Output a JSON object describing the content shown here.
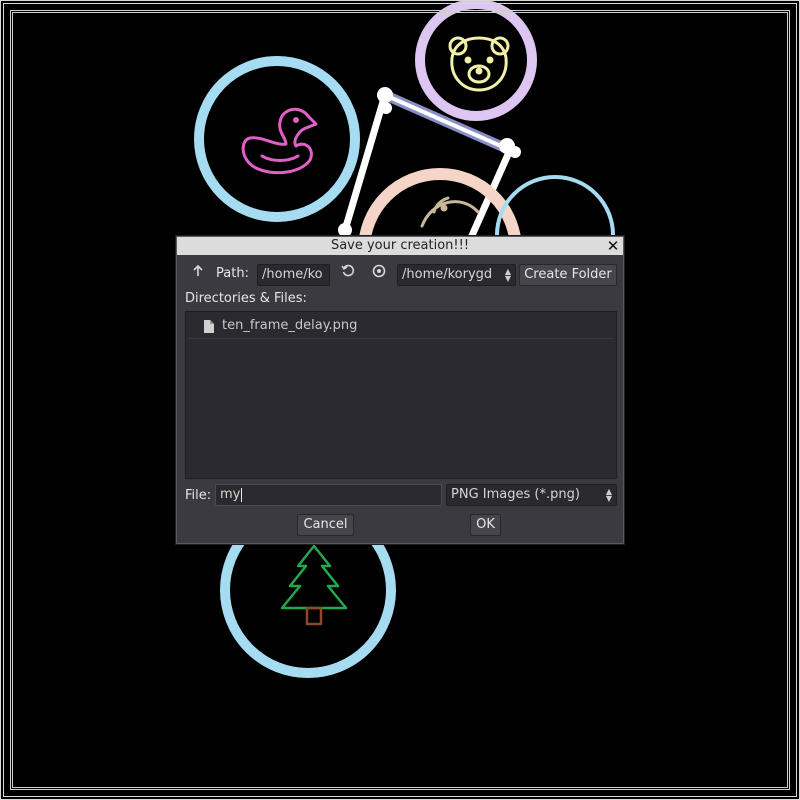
{
  "dialog": {
    "title": "Save your creation!!!",
    "toolbar": {
      "path_label": "Path:",
      "path_value": "/home/ko",
      "dropdown_value": "/home/korygd",
      "create_folder": "Create Folder"
    },
    "list_label": "Directories & Files:",
    "files": [
      {
        "name": "ten_frame_delay.png"
      }
    ],
    "file_label": "File:",
    "file_value": "my",
    "filter_value": "PNG Images (*.png)",
    "cancel_label": "Cancel",
    "ok_label": "OK"
  },
  "colors": {
    "dialog_bg": "#3b3a40",
    "titlebar_bg": "#dcdcdc",
    "ring_blue": "#a6dcf2",
    "ring_purple": "#ddc6f2",
    "ring_peach": "#f5d5c8",
    "duck": "#e060c8",
    "bear": "#f2f0a6",
    "tree": "#22a84a"
  },
  "icons": [
    "up-arrow-icon",
    "refresh-icon",
    "eye-icon",
    "close-icon",
    "file-icon",
    "spinner-icon"
  ]
}
